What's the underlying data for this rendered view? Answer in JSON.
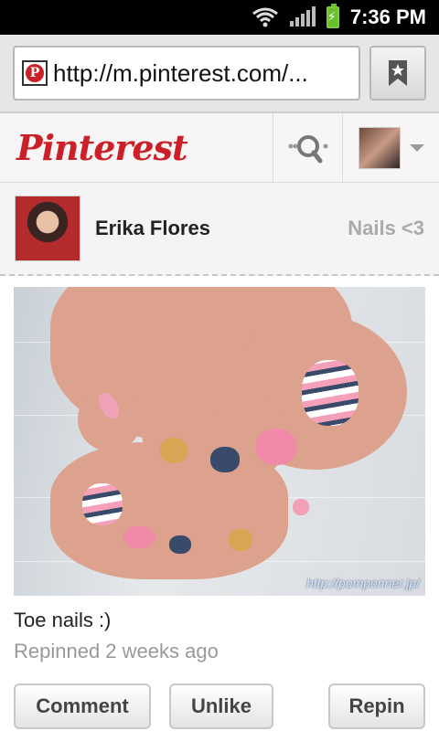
{
  "status_bar": {
    "time": "7:36 PM"
  },
  "browser": {
    "url": "http://m.pinterest.com/..."
  },
  "header": {
    "logo": "Pinterest"
  },
  "pinner": {
    "name": "Erika Flores",
    "board": "Nails <3"
  },
  "pin": {
    "watermark": "http://pomponner.jp/",
    "caption": "Toe nails :)",
    "meta": "Repinned 2 weeks ago"
  },
  "actions": {
    "comment": "Comment",
    "unlike": "Unlike",
    "repin": "Repin"
  },
  "icons": {
    "wifi": "wifi-icon",
    "signal": "signal-icon",
    "battery": "battery-charging-icon",
    "bookmark": "bookmark-star-icon",
    "search": "search-icon",
    "dropdown": "chevron-down-icon"
  },
  "colors": {
    "brand": "#cb2027",
    "battery": "#6abf2c"
  }
}
